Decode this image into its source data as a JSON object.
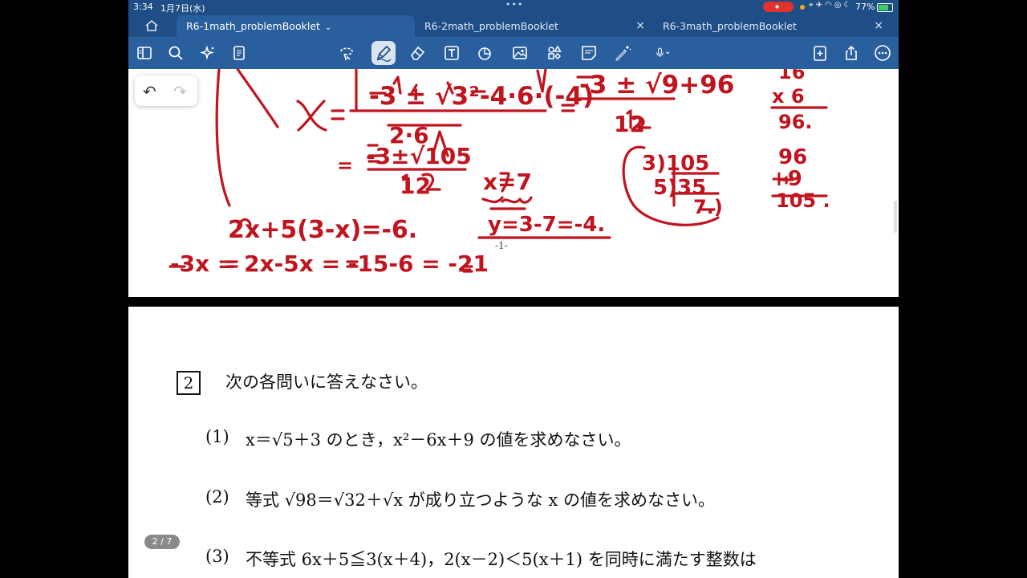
{
  "status": {
    "time": "3:34",
    "date": "1月7日(水)",
    "battery": "77%"
  },
  "tabs": [
    {
      "label": "R6-1math_problemBooklet",
      "active": true
    },
    {
      "label": "R6-2math_problemBooklet",
      "active": false
    },
    {
      "label": "R6-3math_problemBooklet",
      "active": false
    }
  ],
  "toolbar": {
    "icons": [
      "sidebar-icon",
      "search-icon",
      "ai-sparkle-icon",
      "document-icon",
      "lasso-icon",
      "pen-icon",
      "eraser-icon",
      "text-icon",
      "shapes-icon",
      "image-icon",
      "elements-icon",
      "sticky-note-icon",
      "laser-pointer-icon",
      "microphone-icon",
      "add-page-icon",
      "share-icon",
      "more-icon"
    ],
    "selected": "pen-icon"
  },
  "page1": {
    "page_number": "-1-",
    "ink_color": "#c0141e"
  },
  "page2": {
    "problem_number": "2",
    "intro": "次の各問いに答えなさい。",
    "questions": [
      {
        "label": "(1)",
        "text": "x＝√5＋3 のとき，x²－6x＋9 の値を求めなさい。"
      },
      {
        "label": "(2)",
        "text": "等式 √98＝√32＋√x が成り立つような x の値を求めなさい。"
      },
      {
        "label": "(3)",
        "text": "不等式 6x＋5≦3(x＋4)，2(x－2)＜5(x＋1) を同時に満たす整数は"
      }
    ]
  },
  "page_indicator": "2 / 7"
}
